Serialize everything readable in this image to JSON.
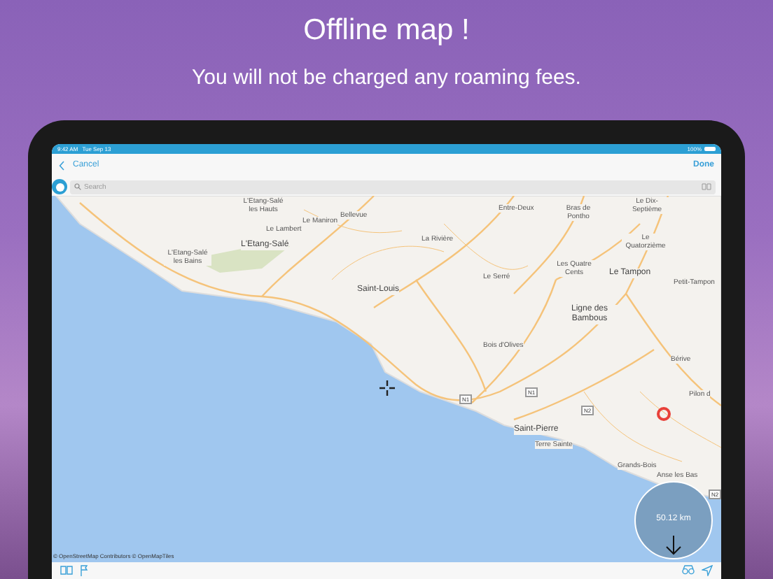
{
  "headline": "Offline map !",
  "subheadline": "You will not be charged any roaming fees.",
  "status_bar": {
    "time": "9:42 AM",
    "date": "Tue Sep 13",
    "battery": "100%"
  },
  "nav": {
    "back": "Cancel",
    "done": "Done"
  },
  "search": {
    "placeholder": "Search"
  },
  "map": {
    "labels": [
      {
        "text": "L'Etang-Salé les Hauts",
        "kind": "place"
      },
      {
        "text": "Bellevue",
        "kind": "place"
      },
      {
        "text": "Le Maniron",
        "kind": "place"
      },
      {
        "text": "Le Lambert",
        "kind": "place"
      },
      {
        "text": "La Rivière",
        "kind": "place"
      },
      {
        "text": "L'Etang-Salé",
        "kind": "town"
      },
      {
        "text": "L'Etang-Salé les Bains",
        "kind": "place"
      },
      {
        "text": "Entre-Deux",
        "kind": "place"
      },
      {
        "text": "Bras de Pontho",
        "kind": "place"
      },
      {
        "text": "Le Dix-Septième",
        "kind": "place"
      },
      {
        "text": "Le Quatorzième",
        "kind": "place"
      },
      {
        "text": "Les Quatre Cents",
        "kind": "place"
      },
      {
        "text": "Le Tampon",
        "kind": "town"
      },
      {
        "text": "Petit-Tampon",
        "kind": "place"
      },
      {
        "text": "Le Serré",
        "kind": "place"
      },
      {
        "text": "Saint-Louis",
        "kind": "town"
      },
      {
        "text": "Ligne des Bambous",
        "kind": "town"
      },
      {
        "text": "Bois d'Olives",
        "kind": "place"
      },
      {
        "text": "Bérive",
        "kind": "place"
      },
      {
        "text": "Pilon d",
        "kind": "place"
      },
      {
        "text": "Saint-Pierre",
        "kind": "town"
      },
      {
        "text": "Terre Sainte",
        "kind": "place"
      },
      {
        "text": "Grands-Bois",
        "kind": "place"
      },
      {
        "text": "Anse les Bas",
        "kind": "place"
      },
      {
        "text": "N1",
        "kind": "road"
      },
      {
        "text": "N1",
        "kind": "road"
      },
      {
        "text": "N2",
        "kind": "road"
      },
      {
        "text": "N2",
        "kind": "road"
      }
    ],
    "distance": "50.12 km",
    "attribution": "© OpenStreetMap Contributors © OpenMapTiles"
  }
}
